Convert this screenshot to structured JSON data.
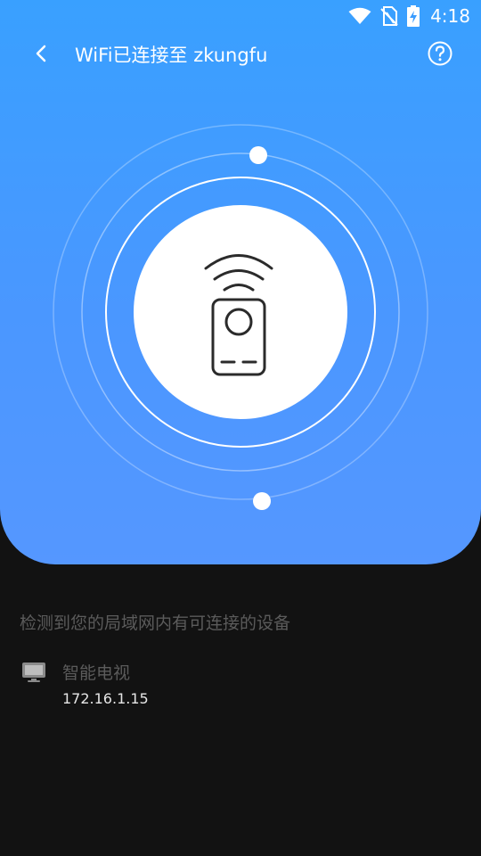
{
  "status_bar": {
    "time": "4:18",
    "icons": [
      "wifi-icon",
      "no-sim-icon",
      "battery-charging-icon"
    ]
  },
  "app_bar": {
    "back_icon": "chevron-left-icon",
    "title": "WiFi已连接至 zkungfu",
    "help_icon": "question-circle-icon"
  },
  "hero": {
    "center_icon": "remote-control-icon",
    "colors": {
      "top": "#39a0ff",
      "bottom": "#5597ff"
    }
  },
  "devices_section": {
    "label": "检测到您的局域网内有可连接的设备",
    "items": [
      {
        "icon": "tv-icon",
        "name": "智能电视",
        "ip": "172.16.1.15"
      }
    ]
  }
}
